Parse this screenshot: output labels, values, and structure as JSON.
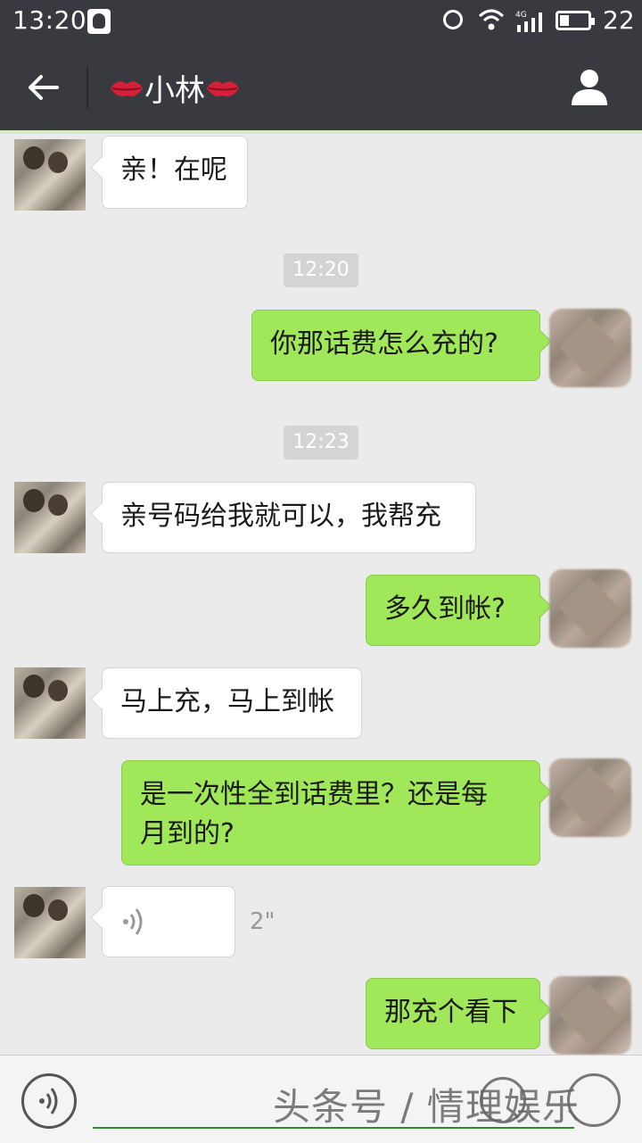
{
  "status_bar": {
    "time": "13:20",
    "network": "4G",
    "battery": "22"
  },
  "header": {
    "title": "小林"
  },
  "messages": [
    {
      "side": "left",
      "type": "text",
      "text": "亲！在呢"
    },
    {
      "type": "time",
      "text": "12:20"
    },
    {
      "side": "right",
      "type": "text",
      "text": "你那话费怎么充的?"
    },
    {
      "type": "time",
      "text": "12:23"
    },
    {
      "side": "left",
      "type": "text",
      "text": "亲号码给我就可以，我帮充"
    },
    {
      "side": "right",
      "type": "text",
      "text": "多久到帐?"
    },
    {
      "side": "left",
      "type": "text",
      "text": "马上充，马上到帐"
    },
    {
      "side": "right",
      "type": "text",
      "text": "是一次性全到话费里？还是每月到的?"
    },
    {
      "side": "left",
      "type": "voice",
      "duration": "2\""
    },
    {
      "side": "right",
      "type": "text",
      "text": "那充个看下"
    }
  ],
  "watermark": "头条号 / 情理娱乐",
  "colors": {
    "header_bg": "#393a3f",
    "chat_bg": "#ebebeb",
    "sent_bubble": "#a0e75a",
    "received_bubble": "#ffffff"
  }
}
